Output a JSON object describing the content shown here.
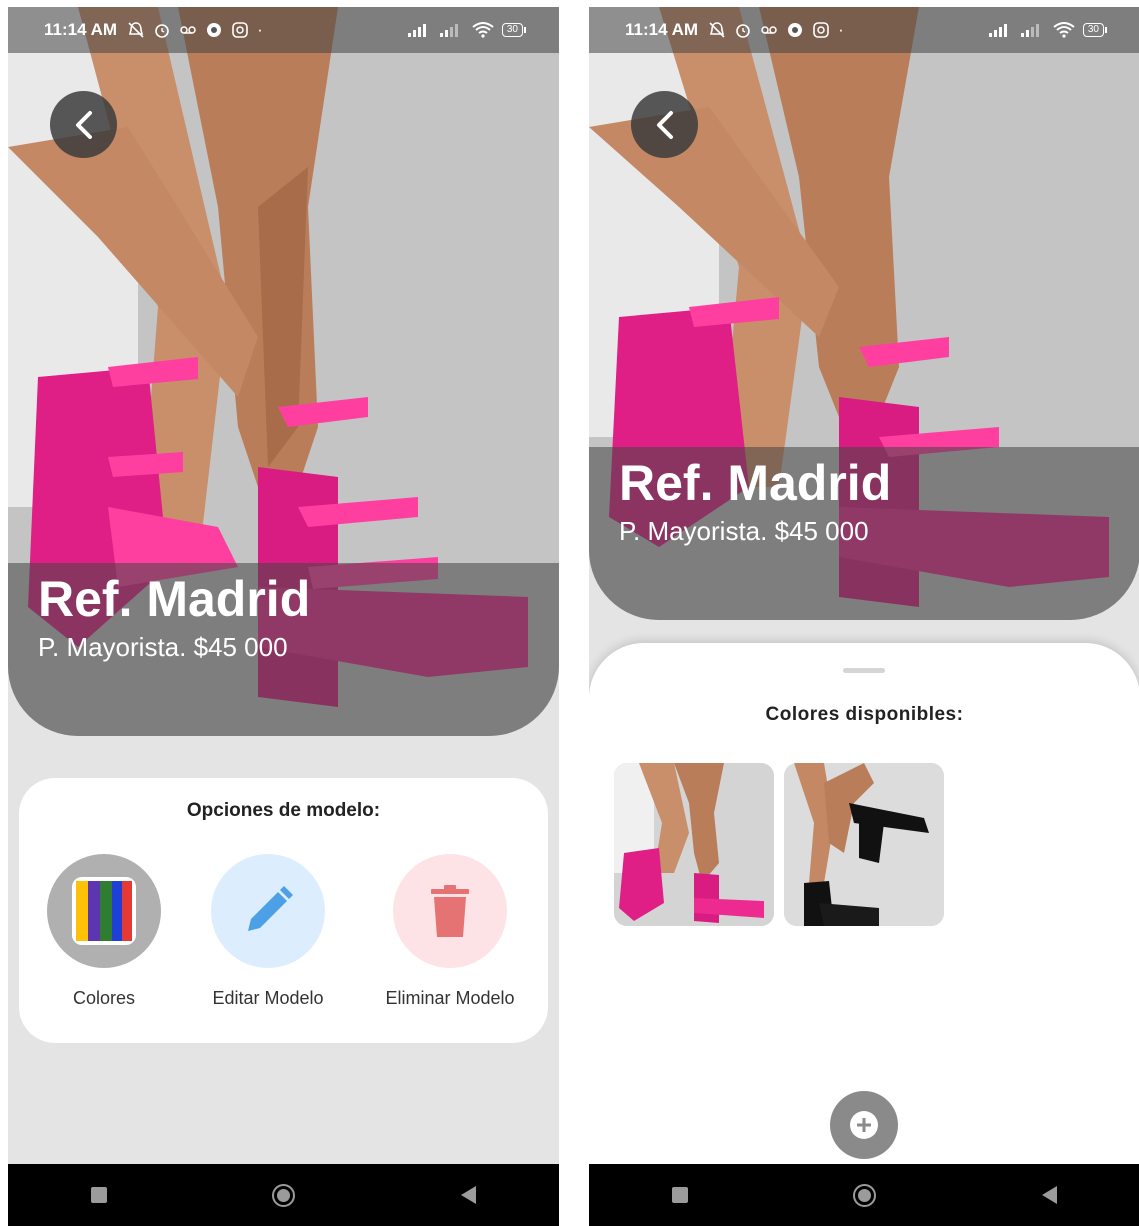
{
  "status_bar": {
    "time": "11:14 AM",
    "battery": "30"
  },
  "model": {
    "title": "Ref. Madrid",
    "price": "P. Mayorista. $45 000"
  },
  "options": {
    "title": "Opciones de modelo:",
    "items": [
      {
        "label": "Colores",
        "icon": "color-stripes-icon"
      },
      {
        "label": "Editar Modelo",
        "icon": "pencil-icon"
      },
      {
        "label": "Eliminar Modelo",
        "icon": "trash-icon"
      }
    ]
  },
  "sheet": {
    "title": "Colores disponibles:",
    "colors": [
      {
        "name": "pink-sandal-thumbnail",
        "swatch": "#e91e8c"
      },
      {
        "name": "black-sandal-thumbnail",
        "swatch": "#111111"
      }
    ]
  },
  "colors": {
    "accent_pink": "#e91e8c",
    "edit_blue": "#4d9fe6",
    "delete_red": "#e57373"
  }
}
